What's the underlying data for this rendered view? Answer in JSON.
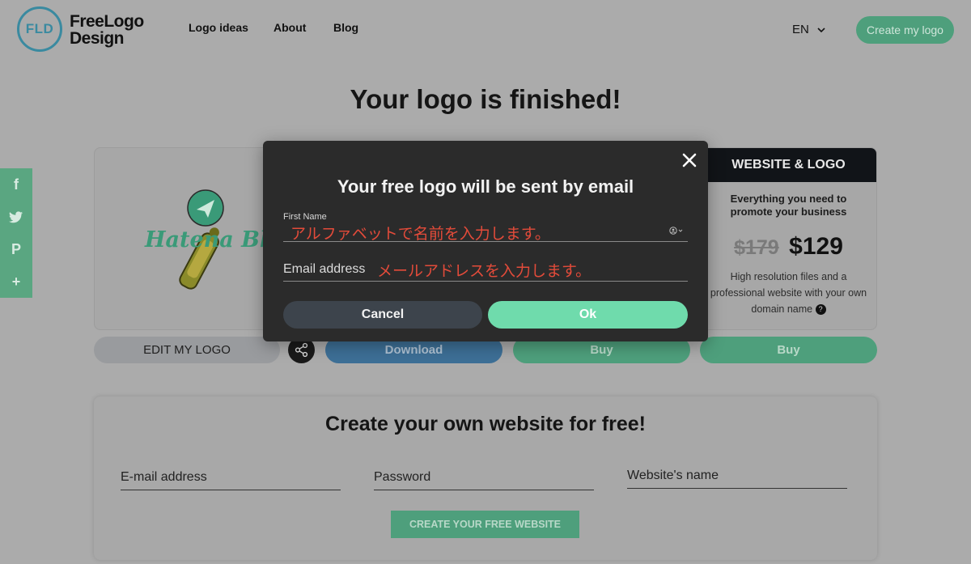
{
  "header": {
    "logo_mark": "FLD",
    "logo_line1": "FreeLogo",
    "logo_line2": "Design",
    "nav": [
      "Logo ideas",
      "About",
      "Blog"
    ],
    "language": "EN",
    "create_button": "Create my logo"
  },
  "page_title": "Your logo is finished!",
  "logo_preview": {
    "text": "Hatena Blog",
    "accent_color": "#3a9a78"
  },
  "pricing": {
    "header": "WEBSITE & LOGO",
    "tagline": "Everything you need to promote your business",
    "old_price": "$179",
    "new_price": "$129",
    "description": "High resolution files and a professional website with your own domain name",
    "help_icon": "?"
  },
  "actions": {
    "edit": "EDIT MY LOGO",
    "download": "Download",
    "buy1": "Buy",
    "buy2": "Buy"
  },
  "website": {
    "title": "Create your own website for free!",
    "email_label": "E-mail address",
    "password_label": "Password",
    "name_label": "Website's name",
    "button": "CREATE YOUR FREE WEBSITE"
  },
  "modal": {
    "title": "Your free logo will be sent by email",
    "first_name_label": "First Name",
    "first_name_value": "アルファベットで名前を入力します。",
    "email_label": "Email address",
    "email_value": "メールアドレスを入力します。",
    "cancel": "Cancel",
    "ok": "Ok"
  },
  "social": {
    "icons": [
      "f",
      "twitter-icon",
      "p",
      "+"
    ]
  },
  "colors": {
    "overlay_bg": "#ababab",
    "green": "#4e9f7c",
    "ok_green": "#6fdbac",
    "modal_bg": "#2b2b2b",
    "annotation_red": "#e34b3a"
  }
}
